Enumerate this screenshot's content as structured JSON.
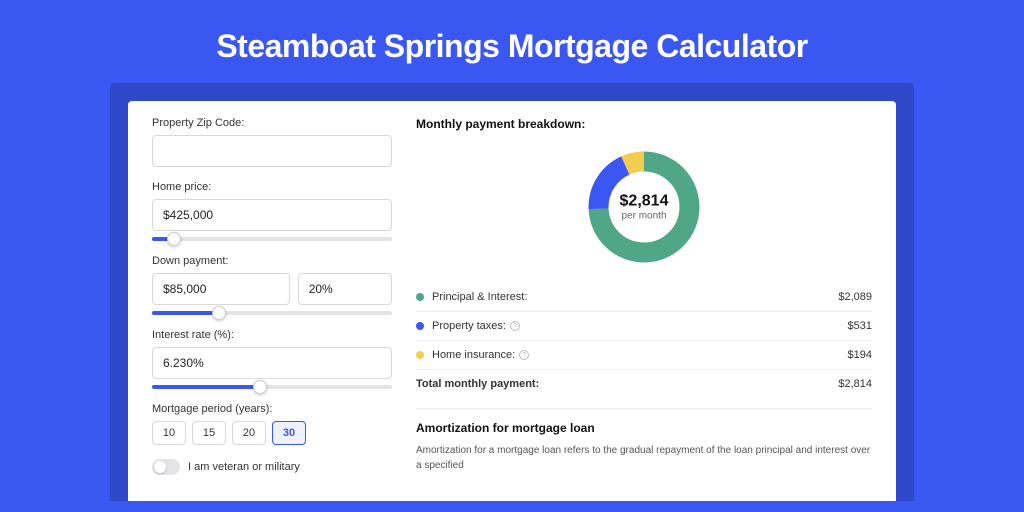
{
  "title": "Steamboat Springs Mortgage Calculator",
  "form": {
    "zip_label": "Property Zip Code:",
    "zip_value": "",
    "home_price_label": "Home price:",
    "home_price_value": "$425,000",
    "home_price_slider_pct": 9,
    "down_payment_label": "Down payment:",
    "down_payment_value": "$85,000",
    "down_payment_pct": "20%",
    "down_payment_slider_pct": 28,
    "interest_label": "Interest rate (%):",
    "interest_value": "6.230%",
    "interest_slider_pct": 45,
    "period_label": "Mortgage period (years):",
    "periods": [
      "10",
      "15",
      "20",
      "30"
    ],
    "period_active": "30",
    "veteran_label": "I am veteran or military"
  },
  "breakdown": {
    "title": "Monthly payment breakdown:",
    "center_value": "$2,814",
    "center_sub": "per month",
    "items": [
      {
        "label": "Principal & Interest:",
        "value": "$2,089",
        "color": "#4fa788",
        "has_info": false
      },
      {
        "label": "Property taxes:",
        "value": "$531",
        "color": "#3a57f2",
        "has_info": true
      },
      {
        "label": "Home insurance:",
        "value": "$194",
        "color": "#f2cd4f",
        "has_info": true
      }
    ],
    "total_label": "Total monthly payment:",
    "total_value": "$2,814"
  },
  "amortization": {
    "title": "Amortization for mortgage loan",
    "text": "Amortization for a mortgage loan refers to the gradual repayment of the loan principal and interest over a specified"
  },
  "chart_data": {
    "type": "pie",
    "title": "Monthly payment breakdown",
    "series": [
      {
        "name": "Principal & Interest",
        "value": 2089,
        "color": "#4fa788"
      },
      {
        "name": "Property taxes",
        "value": 531,
        "color": "#3a57f2"
      },
      {
        "name": "Home insurance",
        "value": 194,
        "color": "#f2cd4f"
      }
    ],
    "total": 2814
  }
}
